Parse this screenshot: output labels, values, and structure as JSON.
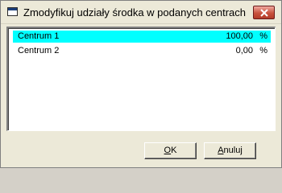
{
  "window": {
    "title": "Zmodyfikuj udziały środka w podanych centrach"
  },
  "list": {
    "rows": [
      {
        "name": "Centrum 1",
        "value": "100,00",
        "unit": "%",
        "selected": true
      },
      {
        "name": "Centrum 2",
        "value": "0,00",
        "unit": "%",
        "selected": false
      }
    ]
  },
  "buttons": {
    "ok_label_mnemonic": "O",
    "ok_label_rest": "K",
    "cancel_label_mnemonic": "A",
    "cancel_label_rest": "nuluj"
  },
  "icons": {
    "app": "window-icon",
    "close": "close-icon"
  },
  "colors": {
    "selection": "#00ffff",
    "window_bg": "#ece9d8",
    "close_button": "#c8523e"
  }
}
